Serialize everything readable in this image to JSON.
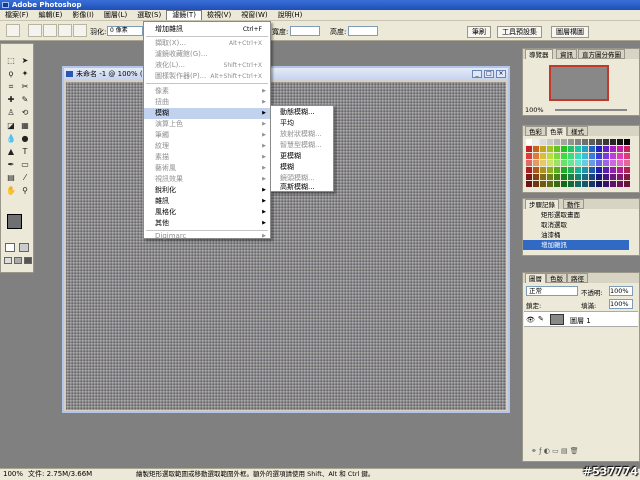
{
  "app": {
    "title": "Adobe Photoshop"
  },
  "menubar": [
    "檔案(F)",
    "編輯(E)",
    "影像(I)",
    "圖層(L)",
    "選取(S)",
    "濾鏡(T)",
    "檢視(V)",
    "視窗(W)",
    "說明(H)"
  ],
  "options": {
    "feather_label": "羽化:",
    "feather_value": "0 像素",
    "width_label": "寬度:",
    "height_label": "高度:"
  },
  "palette_tabs": [
    "筆刷",
    "工具預設集",
    "圖層構圖"
  ],
  "document": {
    "title": "未命名 -1 @ 100% (圖層..."
  },
  "filter_menu": {
    "items": [
      {
        "label": "增加雜訊",
        "shortcut": "Ctrl+F",
        "state": "normal"
      },
      {
        "label": "擷取(X)...",
        "shortcut": "Alt+Ctrl+X",
        "state": "disabled"
      },
      {
        "label": "濾鏡收藏館(G)...",
        "shortcut": "",
        "state": "disabled"
      },
      {
        "label": "液化(L)...",
        "shortcut": "Shift+Ctrl+X",
        "state": "disabled"
      },
      {
        "label": "圖樣製作器(P)...",
        "shortcut": "Alt+Shift+Ctrl+X",
        "state": "disabled"
      },
      {
        "label": "像素",
        "submenu": true,
        "state": "disabled"
      },
      {
        "label": "扭曲",
        "submenu": true,
        "state": "disabled"
      },
      {
        "label": "模糊",
        "submenu": true,
        "state": "highlight"
      },
      {
        "label": "演算上色",
        "submenu": true,
        "state": "disabled"
      },
      {
        "label": "筆觸",
        "submenu": true,
        "state": "disabled"
      },
      {
        "label": "紋理",
        "submenu": true,
        "state": "disabled"
      },
      {
        "label": "素描",
        "submenu": true,
        "state": "disabled"
      },
      {
        "label": "藝術風",
        "submenu": true,
        "state": "disabled"
      },
      {
        "label": "視訊效果",
        "submenu": true,
        "state": "disabled"
      },
      {
        "label": "銳利化",
        "submenu": true,
        "state": "normal"
      },
      {
        "label": "雜訊",
        "submenu": true,
        "state": "normal"
      },
      {
        "label": "風格化",
        "submenu": true,
        "state": "normal"
      },
      {
        "label": "其他",
        "submenu": true,
        "state": "normal"
      },
      {
        "label": "Digimarc",
        "submenu": true,
        "state": "disabled"
      }
    ]
  },
  "blur_submenu": [
    {
      "label": "動態模糊...",
      "state": "normal"
    },
    {
      "label": "平均",
      "state": "normal"
    },
    {
      "label": "放射狀模糊...",
      "state": "disabled"
    },
    {
      "label": "智慧型模糊...",
      "state": "disabled"
    },
    {
      "label": "更模糊",
      "state": "normal"
    },
    {
      "label": "模糊",
      "state": "normal"
    },
    {
      "label": "鏡頭模糊...",
      "state": "disabled"
    },
    {
      "label": "高斯模糊...",
      "state": "normal"
    }
  ],
  "navigator": {
    "tabs": [
      "導覽器",
      "資訊",
      "直方圖分佈圖"
    ],
    "zoom": "100%"
  },
  "color_panel": {
    "tabs": [
      "色彩",
      "色票",
      "樣式"
    ]
  },
  "history_panel": {
    "tabs": [
      "步驟記錄",
      "動作"
    ],
    "items": [
      "矩形選取畫面",
      "取消選取",
      "油漆桶",
      "增加雜訊"
    ]
  },
  "layers_panel": {
    "tabs": [
      "圖層",
      "色版",
      "路徑"
    ],
    "blend_mode": "正常",
    "opacity_label": "不透明:",
    "opacity": "100%",
    "lock_label": "鎖定:",
    "fill_label": "填滿:",
    "fill": "100%",
    "layer_name": "圖層 1"
  },
  "status": {
    "zoom": "100%",
    "doc_info": "文件: 2.75M/3.66M",
    "hint": "繪製矩形選取範圍或移動選取範圍外框。額外的選項請使用 Shift、Alt 和 Ctrl 鍵。"
  },
  "watermark": "#537774",
  "colors": {
    "accent": "#316ac5",
    "highlight": "#c1d2ee"
  }
}
